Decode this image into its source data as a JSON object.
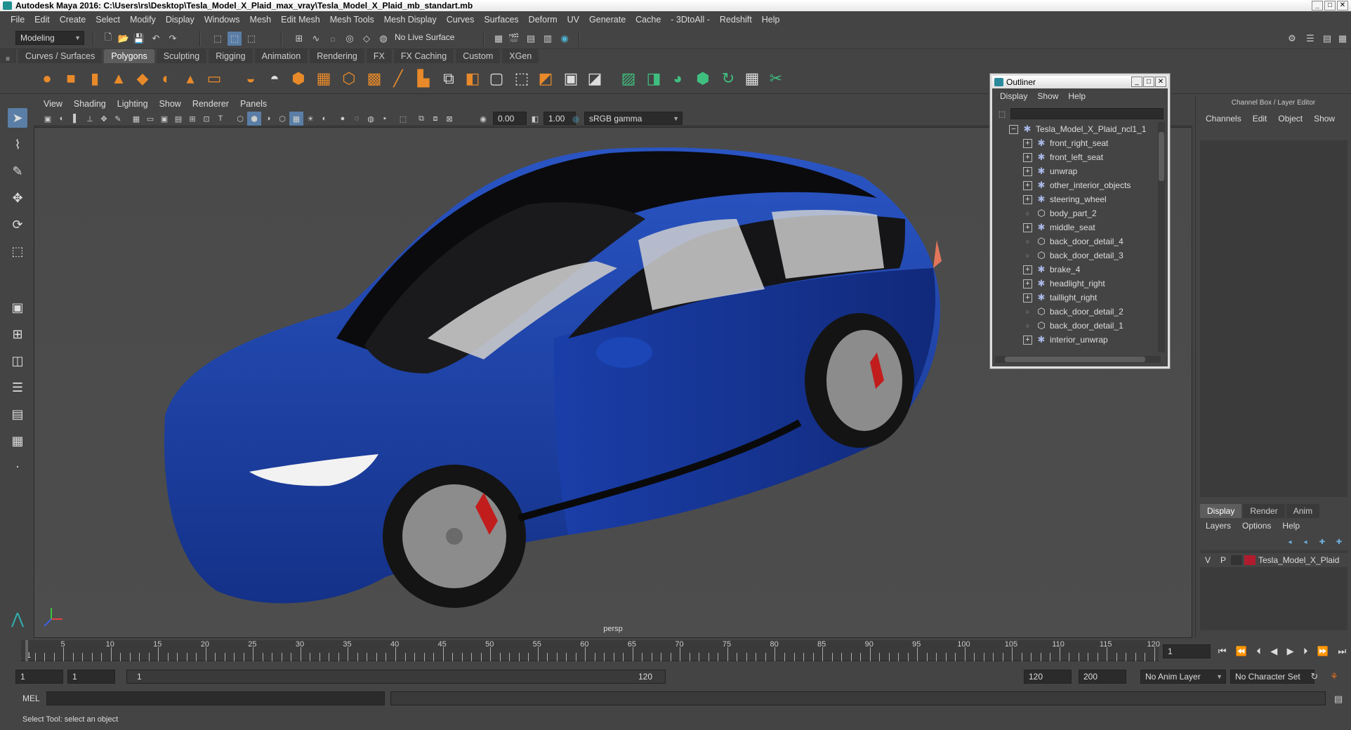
{
  "window": {
    "title": "Autodesk Maya 2016: C:\\Users\\rs\\Desktop\\Tesla_Model_X_Plaid_max_vray\\Tesla_Model_X_Plaid_mb_standart.mb",
    "min": "_",
    "max": "□",
    "close": "✕"
  },
  "menubar": [
    "File",
    "Edit",
    "Create",
    "Select",
    "Modify",
    "Display",
    "Windows",
    "Mesh",
    "Edit Mesh",
    "Mesh Tools",
    "Mesh Display",
    "Curves",
    "Surfaces",
    "Deform",
    "UV",
    "Generate",
    "Cache",
    "- 3DtoAll -",
    "Redshift",
    "Help"
  ],
  "statusline": {
    "menuset": "Modeling",
    "live_surface": "No Live Surface"
  },
  "shelf": {
    "tabs": [
      "Curves / Surfaces",
      "Polygons",
      "Sculpting",
      "Rigging",
      "Animation",
      "Rendering",
      "FX",
      "FX Caching",
      "Custom",
      "XGen"
    ],
    "active": "Polygons"
  },
  "viewport": {
    "menu": [
      "View",
      "Shading",
      "Lighting",
      "Show",
      "Renderer",
      "Panels"
    ],
    "near": "0.00",
    "far": "1.00",
    "color_space": "sRGB gamma",
    "camera_label": "persp"
  },
  "outliner": {
    "title": "Outliner",
    "menu": [
      "Display",
      "Show",
      "Help"
    ],
    "root": "Tesla_Model_X_Plaid_ncl1_1",
    "items": [
      {
        "label": "front_right_seat",
        "kind": "group"
      },
      {
        "label": "front_left_seat",
        "kind": "group"
      },
      {
        "label": "unwrap",
        "kind": "group"
      },
      {
        "label": "other_interior_objects",
        "kind": "group"
      },
      {
        "label": "steering_wheel",
        "kind": "group"
      },
      {
        "label": "body_part_2",
        "kind": "mesh"
      },
      {
        "label": "middle_seat",
        "kind": "group"
      },
      {
        "label": "back_door_detail_4",
        "kind": "mesh"
      },
      {
        "label": "back_door_detail_3",
        "kind": "mesh"
      },
      {
        "label": "brake_4",
        "kind": "group"
      },
      {
        "label": "headlight_right",
        "kind": "group"
      },
      {
        "label": "taillight_right",
        "kind": "group"
      },
      {
        "label": "back_door_detail_2",
        "kind": "mesh"
      },
      {
        "label": "back_door_detail_1",
        "kind": "mesh"
      },
      {
        "label": "interior_unwrap",
        "kind": "group"
      }
    ]
  },
  "channelbox": {
    "header": "Channel Box / Layer Editor",
    "menu": [
      "Channels",
      "Edit",
      "Object",
      "Show"
    ],
    "layer_tabs": [
      "Display",
      "Render",
      "Anim"
    ],
    "layer_menu": [
      "Layers",
      "Options",
      "Help"
    ],
    "layer": {
      "v": "V",
      "p": "P",
      "name": "Tesla_Model_X_Plaid",
      "color": "#b01c2e"
    }
  },
  "timeline": {
    "ticks": [
      "5",
      "10",
      "15",
      "20",
      "25",
      "30",
      "35",
      "40",
      "45",
      "50",
      "55",
      "60",
      "65",
      "70",
      "75",
      "80",
      "85",
      "90",
      "95",
      "100",
      "105",
      "110",
      "115",
      "120"
    ],
    "start_label": "1",
    "current_frame": "1"
  },
  "range": {
    "start": "1",
    "anim_start": "1",
    "slider_start": "1",
    "slider_end": "120",
    "end": "120",
    "anim_end": "200",
    "anim_layer": "No Anim Layer",
    "char_set": "No Character Set"
  },
  "cmdline": {
    "label": "MEL"
  },
  "helpline": "Select Tool: select an object",
  "colors": {
    "car_body": "#1a3fa3",
    "accent_select": "#5a7ea6"
  }
}
